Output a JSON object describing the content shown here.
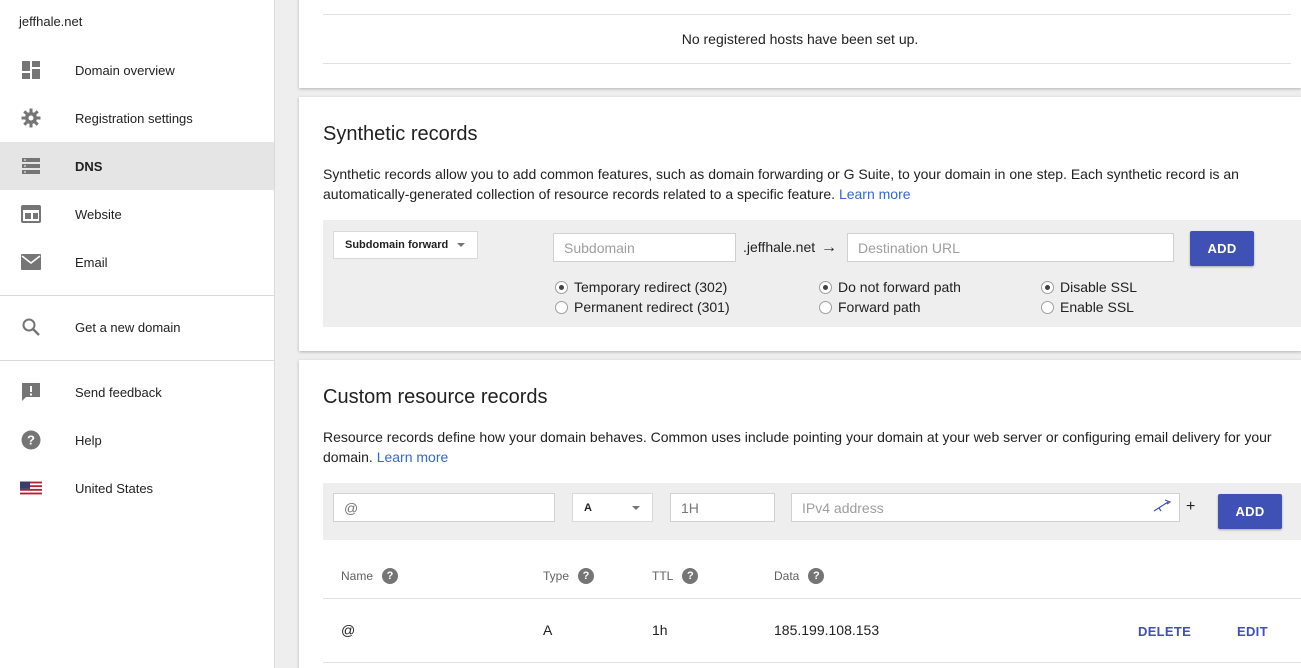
{
  "sidebar": {
    "site_name": "jeffhale.net",
    "items": [
      {
        "label": "Domain overview",
        "icon": "dashboard-icon"
      },
      {
        "label": "Registration settings",
        "icon": "gear-icon"
      },
      {
        "label": "DNS",
        "icon": "dns-icon",
        "active": true
      },
      {
        "label": "Website",
        "icon": "web-icon"
      },
      {
        "label": "Email",
        "icon": "email-icon"
      },
      {
        "label": "Get a new domain",
        "icon": "search-icon"
      },
      {
        "label": "Send feedback",
        "icon": "feedback-icon"
      },
      {
        "label": "Help",
        "icon": "help-icon"
      },
      {
        "label": "United States",
        "icon": "us-flag-icon"
      }
    ]
  },
  "registered_hosts": {
    "empty_message": "No registered hosts have been set up."
  },
  "synthetic": {
    "title": "Synthetic records",
    "description": "Synthetic records allow you to add common features, such as domain forwarding or G Suite, to your domain in one step. Each synthetic record is an automatically-generated collection of resource records related to a specific feature.",
    "learn_more": "Learn more",
    "record_type": "Subdomain forward",
    "subdomain_placeholder": "Subdomain",
    "domain_suffix": ".jeffhale.net",
    "arrow": "→",
    "destination_placeholder": "Destination URL",
    "add_label": "ADD",
    "redirect_options": [
      {
        "label": "Temporary redirect (302)",
        "checked": true
      },
      {
        "label": "Permanent redirect (301)",
        "checked": false
      }
    ],
    "path_options": [
      {
        "label": "Do not forward path",
        "checked": true
      },
      {
        "label": "Forward path",
        "checked": false
      }
    ],
    "ssl_options": [
      {
        "label": "Disable SSL",
        "checked": true
      },
      {
        "label": "Enable SSL",
        "checked": false
      }
    ]
  },
  "custom": {
    "title": "Custom resource records",
    "description": "Resource records define how your domain behaves. Common uses include pointing your domain at your web server or configuring email delivery for your domain.",
    "learn_more": "Learn more",
    "name_value": "@",
    "type_value": "A",
    "ttl_value": "1H",
    "data_placeholder": "IPv4 address",
    "plus": "+",
    "add_label": "ADD",
    "columns": [
      {
        "label": "Name",
        "help": "?"
      },
      {
        "label": "Type",
        "help": "?"
      },
      {
        "label": "TTL",
        "help": "?"
      },
      {
        "label": "Data",
        "help": "?"
      }
    ],
    "rows": [
      {
        "name": "@",
        "type": "A",
        "ttl": "1h",
        "data": "185.199.108.153",
        "delete": "DELETE",
        "edit": "EDIT"
      }
    ]
  },
  "colors": {
    "accent": "#3f51b5",
    "link": "#3367d6",
    "active_nav": "#e5e5e5"
  }
}
